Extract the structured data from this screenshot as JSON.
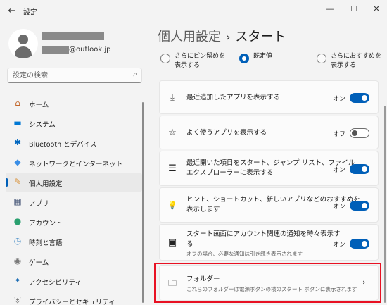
{
  "window": {
    "back_icon": "←",
    "title": "設定",
    "min": "—",
    "max": "☐",
    "close": "✕"
  },
  "profile": {
    "email_domain": "@outlook.jp"
  },
  "search": {
    "placeholder": "設定の検索",
    "icon": "⌕"
  },
  "nav": {
    "items": [
      {
        "label": "ホーム",
        "icon": "home-icon",
        "glyph": "⌂",
        "color": "#c2662a"
      },
      {
        "label": "システム",
        "icon": "system-monitor-icon",
        "glyph": "▬",
        "color": "#0078d4"
      },
      {
        "label": "Bluetooth とデバイス",
        "icon": "bluetooth-icon",
        "glyph": "✱",
        "color": "#0067c0"
      },
      {
        "label": "ネットワークとインターネット",
        "icon": "wifi-icon",
        "glyph": "◆",
        "color": "#3a8ee6"
      },
      {
        "label": "個人用設定",
        "icon": "brush-icon",
        "glyph": "✎",
        "color": "#d88b2b"
      },
      {
        "label": "アプリ",
        "icon": "apps-icon",
        "glyph": "▦",
        "color": "#4a5a7a"
      },
      {
        "label": "アカウント",
        "icon": "account-icon",
        "glyph": "●",
        "color": "#2aa06f"
      },
      {
        "label": "時刻と言語",
        "icon": "clock-globe-icon",
        "glyph": "◷",
        "color": "#2f7fc1"
      },
      {
        "label": "ゲーム",
        "icon": "gamepad-icon",
        "glyph": "◉",
        "color": "#7a7a7a"
      },
      {
        "label": "アクセシビリティ",
        "icon": "accessibility-icon",
        "glyph": "✦",
        "color": "#1f6fb5"
      },
      {
        "label": "プライバシーとセキュリティ",
        "icon": "shield-icon",
        "glyph": "⛨",
        "color": "#6d6d6d"
      }
    ],
    "active_index": 4
  },
  "header": {
    "crumb": "個人用設定",
    "separator": "›",
    "current": "スタート"
  },
  "layout_options": [
    {
      "line1": "さらにピン留めを",
      "line2": "表示する",
      "checked": false
    },
    {
      "line1": "既定値",
      "line2": "",
      "checked": true
    },
    {
      "line1": "さらにおすすめを",
      "line2": "表示する",
      "checked": false
    }
  ],
  "settings": {
    "recent_apps": {
      "icon": "download-icon",
      "glyph": "⤓",
      "label": "最近追加したアプリを表示する",
      "state": "オン"
    },
    "most_used": {
      "icon": "star-icon",
      "glyph": "☆",
      "label": "よく使うアプリを表示する",
      "state": "オフ"
    },
    "recent_items": {
      "icon": "list-icon",
      "glyph": "☰",
      "line1": "最近開いた項目をスタート、ジャンプ リスト、ファイル",
      "line2": "エクスプローラーに表示する",
      "state": "オン"
    },
    "tips": {
      "icon": "lightbulb-icon",
      "glyph": "💡",
      "line1": "ヒント、ショートカット、新しいアプリなどのおすすめを",
      "line2": "表示します",
      "state": "オン"
    },
    "account_notif": {
      "icon": "notification-dot-icon",
      "glyph": "▣",
      "line1": "スタート画面にアカウント関連の通知を時々表示す",
      "line2": "る",
      "sub": "オフの場合、必要な通知は引き続き表示されます",
      "state": "オン"
    },
    "folders": {
      "icon": "folder-icon",
      "glyph": "🗀",
      "label": "フォルダー",
      "sub": "これらのフォルダーは電源ボタンの横のスタート ボタンに表示されます",
      "chevron": "›"
    }
  },
  "colors": {
    "accent": "#005fb8",
    "highlight": "#e81123"
  }
}
